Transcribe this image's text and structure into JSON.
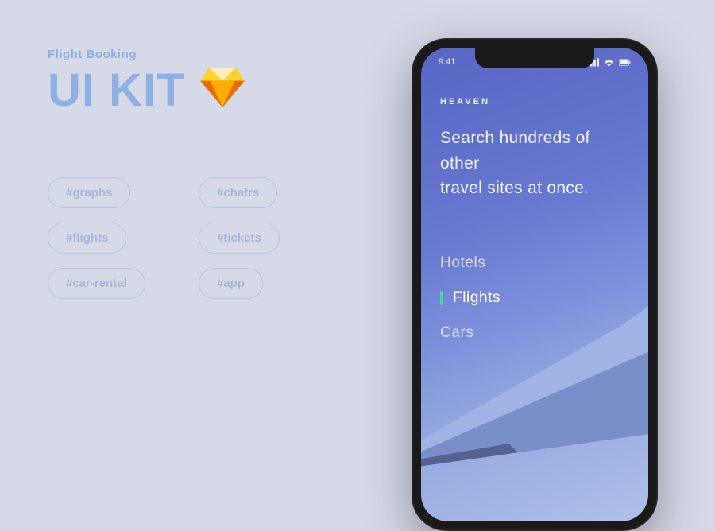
{
  "subtitle": "Flight Booking",
  "title": "UI KIT",
  "tags": [
    "#graphs",
    "#chatrs",
    "#flights",
    "#tickets",
    "#car-rental",
    "#app"
  ],
  "phone": {
    "time": "9:41",
    "brand": "HEAVEN",
    "headline_line1": "Search hundreds of other",
    "headline_line2": "travel sites at once.",
    "nav": {
      "items": [
        "Hotels",
        "Flights",
        "Cars"
      ],
      "active_index": 1
    }
  }
}
